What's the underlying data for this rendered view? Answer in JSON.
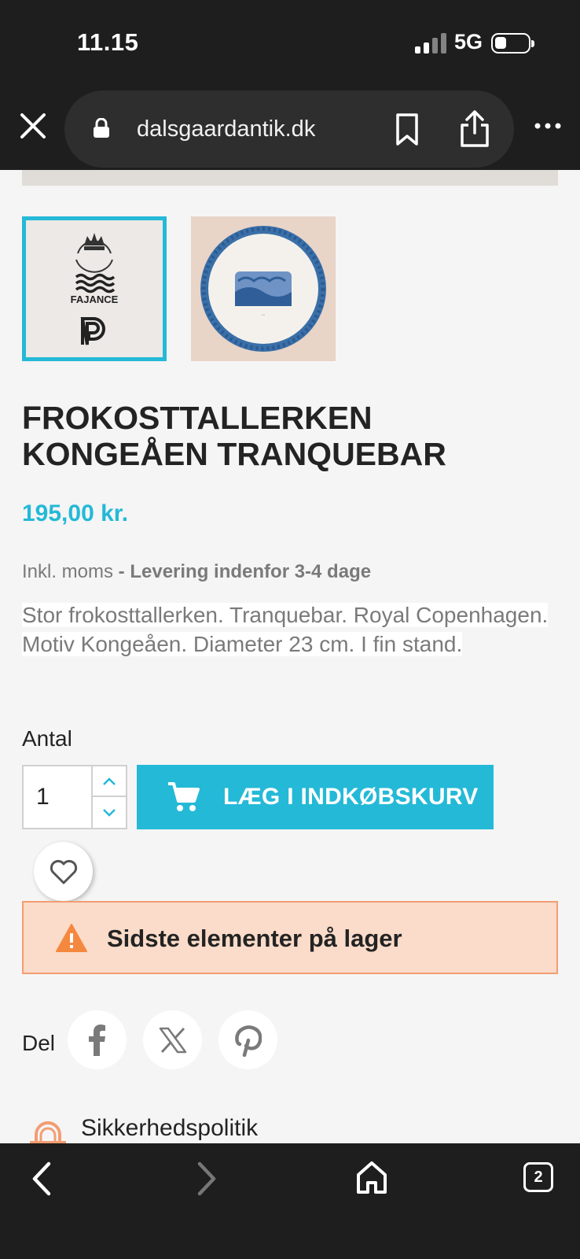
{
  "status_bar": {
    "time": "11.15",
    "network": "5G"
  },
  "browser": {
    "url": "dalsgaardantik.dk",
    "tab_count": "2"
  },
  "product": {
    "thumbnail_1_mark_text": "FAJANCE",
    "title": "FROKOSTTALLERKEN KONGEÅEN TRANQUEBAR",
    "price": "195,00 kr.",
    "tax_label": "Inkl. moms",
    "delivery_label": " - Levering indenfor 3-4 dage",
    "description": "Stor frokosttallerken. Tranquebar. Royal Copenhagen. Motiv Kongeåen. Diameter 23 cm. I fin stand."
  },
  "quantity": {
    "label": "Antal",
    "value": "1"
  },
  "cart": {
    "button_label": "LÆG I INDKØBSKURV"
  },
  "stock": {
    "message": "Sidste elementer på lager"
  },
  "share": {
    "label": "Del",
    "networks": [
      "facebook",
      "x",
      "pinterest"
    ]
  },
  "reassurance": {
    "first_item": "Sikkerhedspolitik"
  },
  "colors": {
    "accent": "#24b9d7",
    "alert_bg": "#fbdbc9",
    "alert_border": "#f39d72",
    "warning": "#f5883f",
    "chrome": "#1e1e1e"
  },
  "icons": [
    "close-icon",
    "lock-icon",
    "bookmark-icon",
    "share-icon",
    "more-icon",
    "chevron-up-icon",
    "chevron-down-icon",
    "cart-icon",
    "heart-icon",
    "warning-icon",
    "facebook-icon",
    "x-icon",
    "pinterest-icon",
    "back-icon",
    "forward-icon",
    "home-icon",
    "tabs-icon"
  ]
}
